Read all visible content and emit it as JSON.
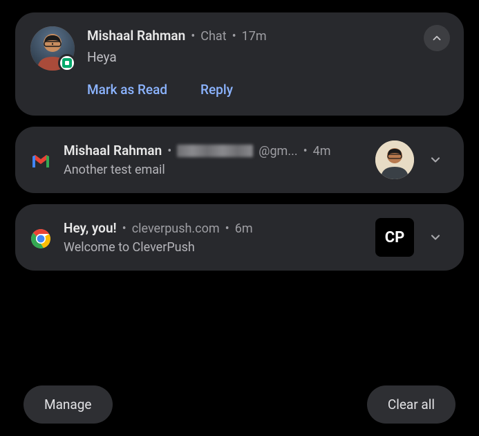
{
  "notifications": [
    {
      "sender": "Mishaal Rahman",
      "app": "Chat",
      "time": "17m",
      "message": "Heya",
      "actions": {
        "mark_read": "Mark as Read",
        "reply": "Reply"
      }
    },
    {
      "sender": "Mishaal Rahman",
      "email_suffix": "@gm...",
      "time": "4m",
      "subject": "Another test email"
    },
    {
      "title": "Hey, you!",
      "source": "cleverpush.com",
      "time": "6m",
      "body": "Welcome to CleverPush",
      "thumb_text": "CP"
    }
  ],
  "footer": {
    "manage": "Manage",
    "clear_all": "Clear all"
  }
}
